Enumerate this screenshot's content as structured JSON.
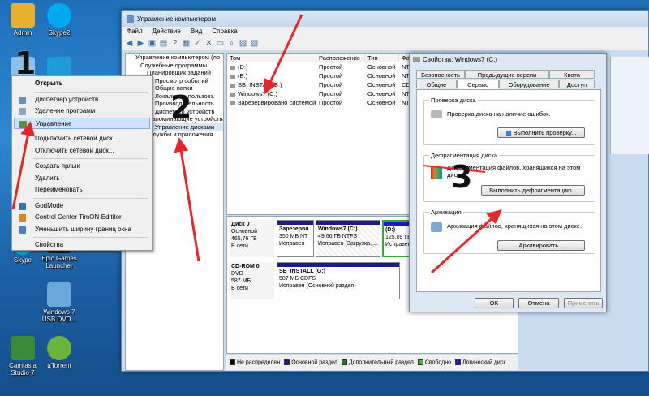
{
  "desktop": {
    "icons": [
      {
        "label": "Admin",
        "color": "#e9b030"
      },
      {
        "label": "Skype2",
        "color": "#00a9f0"
      },
      {
        "label": "Skype",
        "color": "#00a9f0"
      },
      {
        "label": "Epic Games Launcher",
        "color": "#222222"
      },
      {
        "label": "Windows 7 USB DVD...",
        "color": "#6aa8d8"
      },
      {
        "label": "Camtasia Studio 7",
        "color": "#3a8a3a"
      },
      {
        "label": "µTorrent",
        "color": "#6bb33a"
      }
    ]
  },
  "window": {
    "title": "Управление компьютером",
    "menu": [
      "Файл",
      "Действие",
      "Вид",
      "Справка"
    ]
  },
  "tree": [
    "Управление компьютером (ло",
    "Служебные программы",
    "Планировщик заданий",
    "Просмотр событий",
    "Общие папки",
    "Локальные пользова",
    "Производительность",
    "Диспетчер устройств",
    "Запоминающие устройства",
    "Управление дисками",
    "Службы и приложения"
  ],
  "volumes": {
    "columns": [
      "Том",
      "Расположение",
      "Тип",
      "Фа"
    ],
    "rows": [
      [
        "(D:)",
        "Простой",
        "Основной",
        "NTF"
      ],
      [
        "(E:)",
        "Простой",
        "Основной",
        "NTF"
      ],
      [
        "SB_INSTAL (G:)",
        "Простой",
        "Основной",
        "CDF"
      ],
      [
        "Windows7 (C:)",
        "Простой",
        "Основной",
        "NTF"
      ],
      [
        "Зарезервировано системой",
        "Простой",
        "Основной",
        "NTF"
      ]
    ]
  },
  "disks": [
    {
      "name": "Диск 0",
      "type": "Основной",
      "size": "465,76 ГБ",
      "status": "В сети",
      "parts": [
        {
          "name": "Зарезерви",
          "size": "350 МБ NT",
          "state": "Исправен"
        },
        {
          "name": "Windows7 (C:)",
          "size": "49,66 ГБ NTFS",
          "state": "Исправен (Загрузка, ..."
        },
        {
          "name": "(D:)",
          "size": "125,09 ГБ",
          "state": "Исправен"
        }
      ]
    },
    {
      "name": "CD-ROM 0",
      "type": "DVD",
      "size": "587 МБ",
      "status": "В сети",
      "parts": [
        {
          "name": "SB_INSTALL (G:)",
          "size": "587 МБ CDFS",
          "state": "Исправен (Основной раздел)"
        }
      ]
    }
  ],
  "legend": [
    {
      "label": "Не распределен",
      "color": "#000000"
    },
    {
      "label": "Основной раздел",
      "color": "#1a1a8a"
    },
    {
      "label": "Дополнительный раздел",
      "color": "#1f7a1f"
    },
    {
      "label": "Свободно",
      "color": "#39b839"
    },
    {
      "label": "Логический диск",
      "color": "#1a1ad0"
    }
  ],
  "context_menu": {
    "items": [
      "Открыть",
      "Диспетчер устройств",
      "Удаление программ",
      "Управление",
      "Подключить сетевой диск...",
      "Отключить сетевой диск...",
      "Создать ярлык",
      "Удалить",
      "Переименовать",
      "GodMode",
      "Control Center TimON-Edititon",
      "Уменьшить ширину границ окна",
      "Свойства"
    ]
  },
  "dialog": {
    "title": "Свойства: Windows7 (C:)",
    "tabs_top": [
      "Безопасность",
      "Предыдущие версии",
      "Квота"
    ],
    "tabs_bottom": [
      "Общие",
      "Сервис",
      "Оборудование",
      "Доступ"
    ],
    "groups": [
      {
        "title": "Проверка диска",
        "text": "Проверка диска на наличие ошибок.",
        "button": "Выполнить проверку..."
      },
      {
        "title": "Дефрагментация диска",
        "text": "Дефрагментация файлов, хранящихся на этом диске.",
        "button": "Выполнить дефрагментацию..."
      },
      {
        "title": "Архивация",
        "text": "Архивация файлов, хранящихся на этом диске.",
        "button": "Архивировать..."
      }
    ],
    "buttons": [
      "OK",
      "Отмена",
      "Применить"
    ]
  },
  "annotations": [
    "1",
    "2",
    "3"
  ],
  "accent": "#e8262a"
}
